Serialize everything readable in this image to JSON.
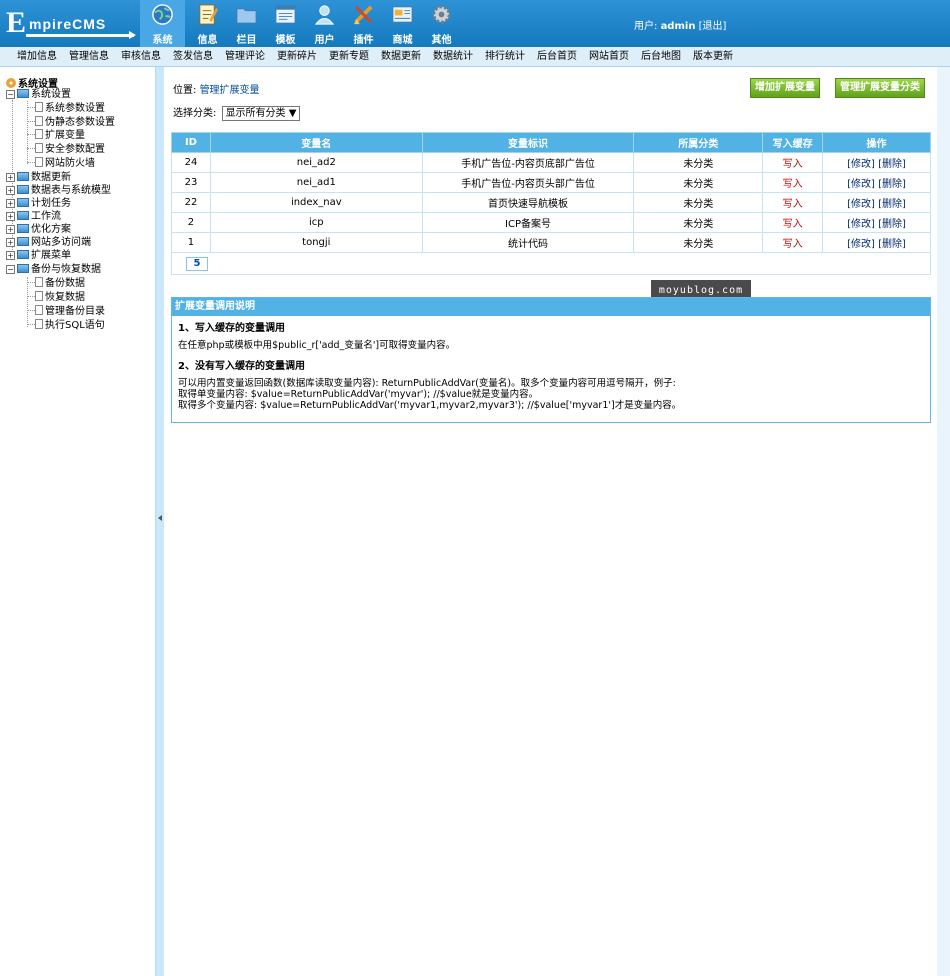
{
  "header": {
    "logo_text": "EmpireCMS",
    "nav": [
      {
        "label": "系统",
        "icon": "globe-icon",
        "active": true
      },
      {
        "label": "信息",
        "icon": "notepad-icon"
      },
      {
        "label": "栏目",
        "icon": "folder-icon"
      },
      {
        "label": "模板",
        "icon": "window-icon"
      },
      {
        "label": "用户",
        "icon": "user-icon"
      },
      {
        "label": "插件",
        "icon": "tools-icon"
      },
      {
        "label": "商城",
        "icon": "shop-icon"
      },
      {
        "label": "其他",
        "icon": "gear-icon"
      }
    ],
    "user_label": "用户:",
    "username": "admin",
    "logout": "[退出]"
  },
  "submenu": [
    "增加信息",
    "管理信息",
    "审核信息",
    "签发信息",
    "管理评论",
    "更新碎片",
    "更新专题",
    "数据更新",
    "数据统计",
    "排行统计",
    "后台首页",
    "网站首页",
    "后台地图",
    "版本更新"
  ],
  "sidebar": {
    "root": "系统设置",
    "items": [
      {
        "label": "系统设置",
        "type": "folder",
        "sign": "−"
      },
      {
        "label": "系统参数设置",
        "type": "doc"
      },
      {
        "label": "伪静态参数设置",
        "type": "doc"
      },
      {
        "label": "扩展变量",
        "type": "doc"
      },
      {
        "label": "安全参数配置",
        "type": "doc"
      },
      {
        "label": "网站防火墙",
        "type": "doc"
      },
      {
        "label": "数据更新",
        "type": "folder",
        "sign": "+"
      },
      {
        "label": "数据表与系统模型",
        "type": "folder",
        "sign": "+"
      },
      {
        "label": "计划任务",
        "type": "folder",
        "sign": "+"
      },
      {
        "label": "工作流",
        "type": "folder",
        "sign": "+"
      },
      {
        "label": "优化方案",
        "type": "folder",
        "sign": "+"
      },
      {
        "label": "网站多访问端",
        "type": "folder",
        "sign": "+"
      },
      {
        "label": "扩展菜单",
        "type": "folder",
        "sign": "+"
      },
      {
        "label": "备份与恢复数据",
        "type": "folder",
        "sign": "−"
      },
      {
        "label": "备份数据",
        "type": "doc"
      },
      {
        "label": "恢复数据",
        "type": "doc"
      },
      {
        "label": "管理备份目录",
        "type": "doc"
      },
      {
        "label": "执行SQL语句",
        "type": "doc"
      }
    ]
  },
  "main": {
    "location_label": "位置:",
    "location_link": "管理扩展变量",
    "filter_label": "选择分类:",
    "filter_value": "显示所有分类",
    "btn_add": "增加扩展变量",
    "btn_manage": "管理扩展变量分类",
    "table": {
      "headers": [
        "ID",
        "变量名",
        "变量标识",
        "所属分类",
        "写入缓存",
        "操作"
      ],
      "rows": [
        {
          "id": "24",
          "name": "nei_ad2",
          "label": "手机广告位-内容页底部广告位",
          "cat": "未分类",
          "cache": "写入",
          "edit": "[修改]",
          "del": "[删除]"
        },
        {
          "id": "23",
          "name": "nei_ad1",
          "label": "手机广告位-内容页头部广告位",
          "cat": "未分类",
          "cache": "写入",
          "edit": "[修改]",
          "del": "[删除]"
        },
        {
          "id": "22",
          "name": "index_nav",
          "label": "首页快速导航模板",
          "cat": "未分类",
          "cache": "写入",
          "edit": "[修改]",
          "del": "[删除]"
        },
        {
          "id": "2",
          "name": "icp",
          "label": "ICP备案号",
          "cat": "未分类",
          "cache": "写入",
          "edit": "[修改]",
          "del": "[删除]"
        },
        {
          "id": "1",
          "name": "tongji",
          "label": "统计代码",
          "cat": "未分类",
          "cache": "写入",
          "edit": "[修改]",
          "del": "[删除]"
        }
      ],
      "pager": "5"
    },
    "watermark": "moyublog.com",
    "help": {
      "title": "扩展变量调用说明",
      "h1": "1、写入缓存的变量调用",
      "p1": "在任意php或模板中用$public_r['add_变量名']可取得变量内容。",
      "h2": "2、没有写入缓存的变量调用",
      "p2": "可以用内置变量返回函数(数据库读取变量内容): ReturnPublicAddVar(变量名)。取多个变量内容可用逗号隔开，例子:",
      "p3": "取得单变量内容: $value=ReturnPublicAddVar('myvar'); //$value就是变量内容。",
      "p4": "取得多个变量内容: $value=ReturnPublicAddVar('myvar1,myvar2,myvar3'); //$value['myvar1']才是变量内容。"
    }
  },
  "colors": {
    "header_blue": "#1f87cc",
    "table_header": "#51b2e3",
    "button_green": "#7cbc30",
    "cache_red": "#cc0000"
  }
}
